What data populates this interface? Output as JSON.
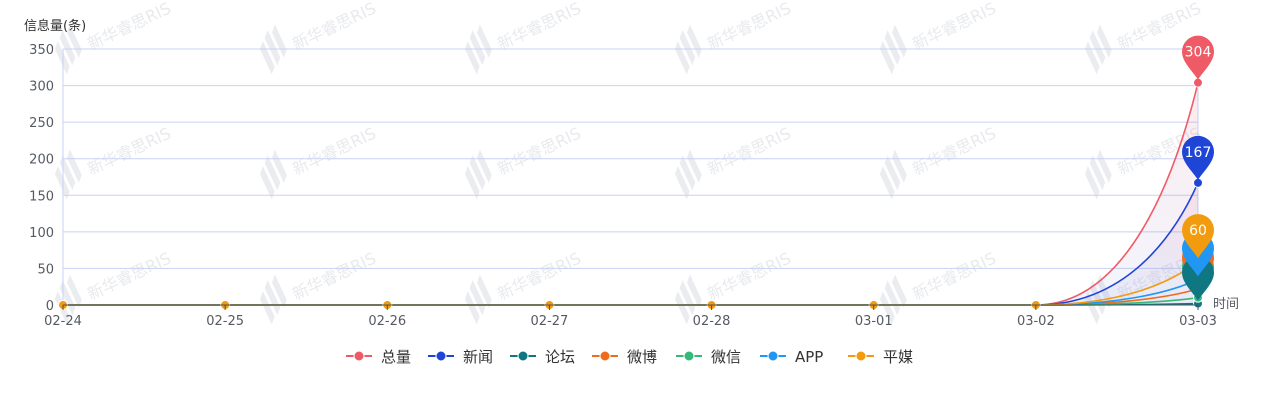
{
  "chart_data": {
    "type": "line",
    "ylabel": "信息量(条)",
    "xlabel": "时间",
    "ylim": [
      0,
      350
    ],
    "yticks": [
      0,
      50,
      100,
      150,
      200,
      250,
      300,
      350
    ],
    "categories": [
      "02-24",
      "02-25",
      "02-26",
      "02-27",
      "02-28",
      "03-01",
      "03-02",
      "03-03"
    ],
    "series": [
      {
        "name": "总量",
        "color": "#ee5b66",
        "values": [
          0,
          0,
          0,
          0,
          0,
          0,
          0,
          304
        ],
        "pin": "304"
      },
      {
        "name": "新闻",
        "color": "#1f45d6",
        "values": [
          0,
          0,
          0,
          0,
          0,
          0,
          0,
          167
        ],
        "pin": "167"
      },
      {
        "name": "论坛",
        "color": "#0f7782",
        "values": [
          0,
          0,
          0,
          0,
          0,
          0,
          0,
          2
        ],
        "pin": ""
      },
      {
        "name": "微博",
        "color": "#ef6c1c",
        "values": [
          0,
          0,
          0,
          0,
          0,
          0,
          0,
          22
        ],
        "pin": ""
      },
      {
        "name": "微信",
        "color": "#35b87a",
        "values": [
          0,
          0,
          0,
          0,
          0,
          0,
          0,
          10
        ],
        "pin": "10"
      },
      {
        "name": "APP",
        "color": "#2196f3",
        "values": [
          0,
          0,
          0,
          0,
          0,
          0,
          0,
          35
        ],
        "pin": ""
      },
      {
        "name": "平媒",
        "color": "#f29b0f",
        "values": [
          0,
          0,
          0,
          0,
          0,
          0,
          0,
          60
        ],
        "pin": "60"
      }
    ],
    "grid": true,
    "legend_position": "bottom-center",
    "watermark": "新华睿思RIS"
  }
}
